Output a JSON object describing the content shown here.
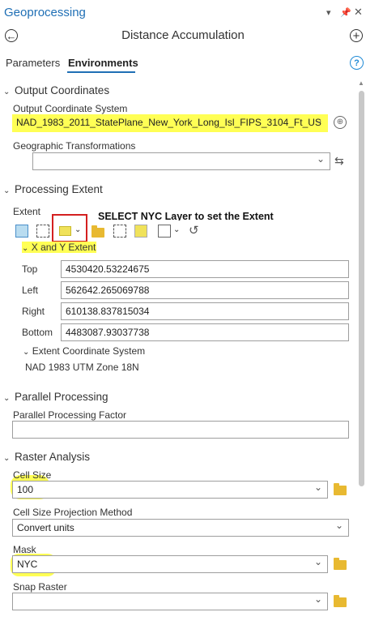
{
  "header": {
    "title": "Geoprocessing",
    "tool_name": "Distance Accumulation"
  },
  "tabs": [
    {
      "label": "Parameters"
    },
    {
      "label": "Environments"
    }
  ],
  "output_coordinates": {
    "section": "Output Coordinates",
    "coord_system_label": "Output Coordinate System",
    "coord_system_value": "NAD_1983_2011_StatePlane_New_York_Long_Isl_FIPS_3104_Ft_US",
    "geo_transform_label": "Geographic Transformations",
    "geo_transform_value": ""
  },
  "processing_extent": {
    "section": "Processing Extent",
    "extent_label": "Extent",
    "annotation": "SELECT NYC Layer to set the Extent",
    "xy_label": "X and Y Extent",
    "top_label": "Top",
    "top_value": "4530420.53224675",
    "left_label": "Left",
    "left_value": "562642.265069788",
    "right_label": "Right",
    "right_value": "610138.837815034",
    "bottom_label": "Bottom",
    "bottom_value": "4483087.93037738",
    "ecs_label": "Extent Coordinate System",
    "ecs_value": "NAD 1983 UTM Zone 18N"
  },
  "parallel_processing": {
    "section": "Parallel Processing",
    "factor_label": "Parallel Processing Factor",
    "factor_value": ""
  },
  "raster_analysis": {
    "section": "Raster Analysis",
    "cell_size_label": "Cell Size",
    "cell_size_value": "100",
    "projection_label": "Cell Size Projection Method",
    "projection_value": "Convert units",
    "mask_label": "Mask",
    "mask_value": "NYC",
    "snap_label": "Snap Raster",
    "snap_value": ""
  },
  "colors": {
    "accent": "#1f6fb5",
    "highlight": "#ffff55",
    "annotation_box": "#d42020",
    "folder": "#e8b931"
  }
}
